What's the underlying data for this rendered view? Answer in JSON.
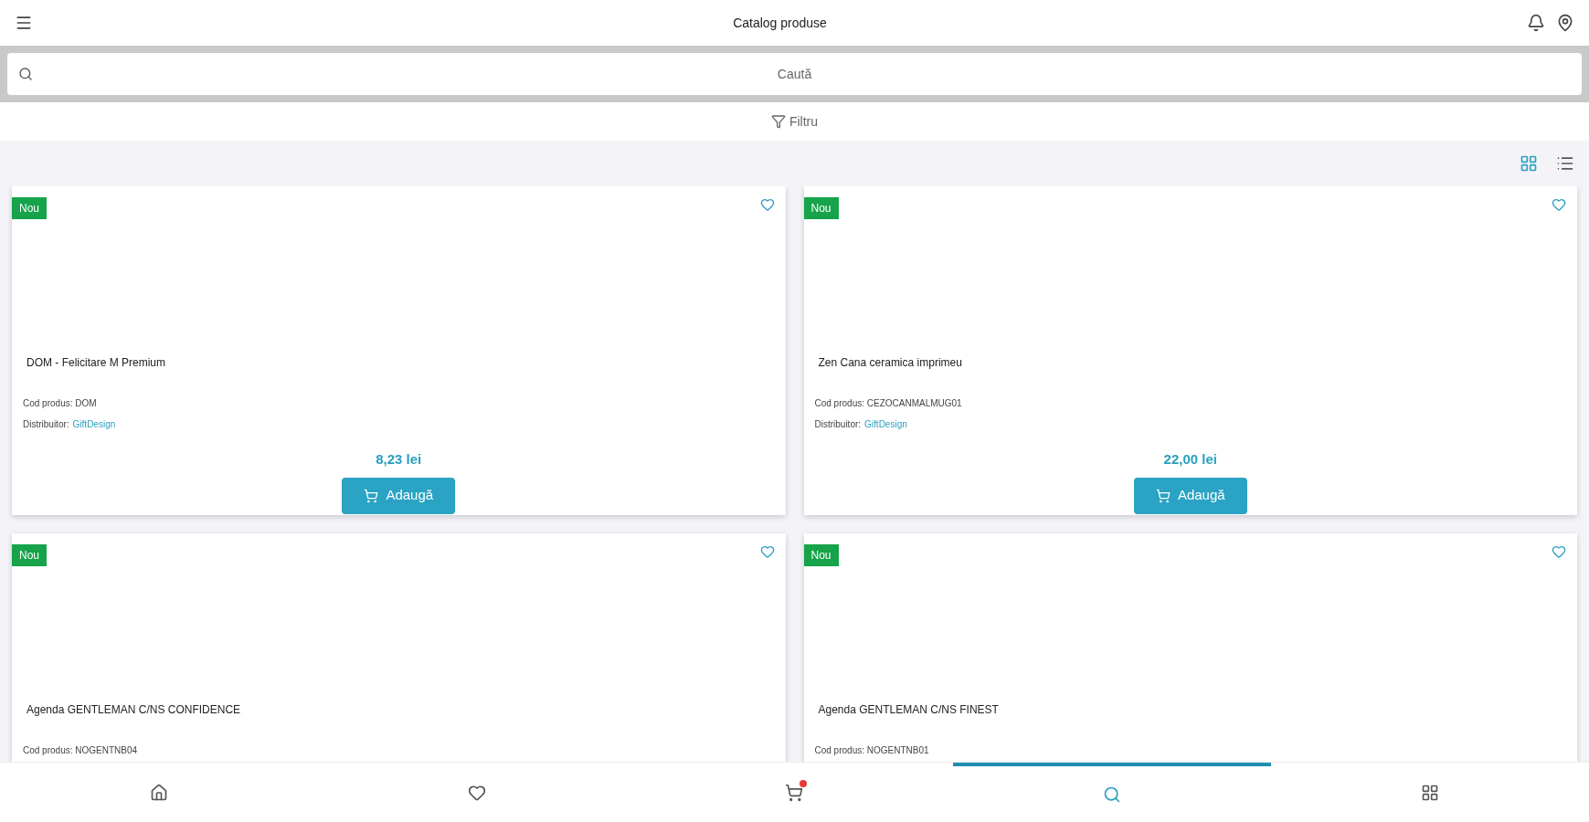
{
  "header": {
    "title": "Catalog produse"
  },
  "search": {
    "placeholder": "Caută"
  },
  "filter": {
    "label": "Filtru"
  },
  "view_toggle": [
    {
      "kind": "grid",
      "selected": true
    },
    {
      "kind": "list",
      "selected": false
    }
  ],
  "products": [
    {
      "badge": "Nou",
      "favorite": false,
      "name": "DOM - Felicitare M Premium",
      "code": "Cod produs: DOM",
      "distributor_label": "Distribuitor:",
      "distributor": "GiftDesign",
      "price": "8,23 lei",
      "button": "Adaugă"
    },
    {
      "badge": "Nou",
      "favorite": false,
      "name": "Zen Cana ceramica imprimeu",
      "code": "Cod produs: CEZOCANMALMUG01",
      "distributor_label": "Distribuitor:",
      "distributor": "GiftDesign",
      "price": "22,00 lei",
      "button": "Adaugă"
    },
    {
      "badge": "Nou",
      "favorite": false,
      "name": "Agenda GENTLEMAN C/NS CONFIDENCE",
      "code": "Cod produs: NOGENTNB04"
    },
    {
      "badge": "Nou",
      "favorite": false,
      "name": "Agenda GENTLEMAN C/NS FINEST",
      "code": "Cod produs: NOGENTNB01"
    }
  ],
  "bottom_nav": [
    {
      "kind": "home",
      "selected": false,
      "badge": false
    },
    {
      "kind": "heart",
      "selected": false,
      "badge": false
    },
    {
      "kind": "cart",
      "selected": false,
      "badge": true
    },
    {
      "kind": "search",
      "selected": true,
      "badge": false
    },
    {
      "kind": "grid",
      "selected": false,
      "badge": false
    }
  ]
}
